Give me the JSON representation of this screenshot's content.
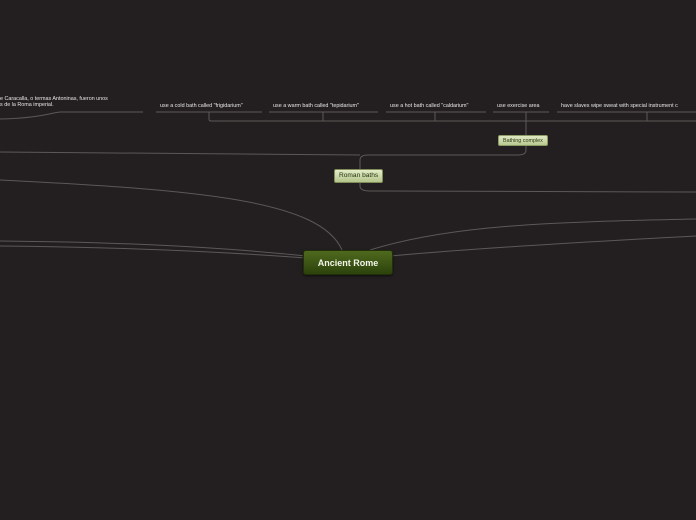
{
  "root": {
    "label": "Ancient Rome"
  },
  "branch": {
    "label": "Roman baths"
  },
  "sub_branch": {
    "label": "Bathing complex"
  },
  "leaves": [
    {
      "label": "use a cold bath called \"frigidarium\""
    },
    {
      "label": "use a warm bath called \"tepidarium\""
    },
    {
      "label": "use a hot bath called \"caldarium\""
    },
    {
      "label": "use exercise area"
    },
    {
      "label": "have slaves wipe sweat with special instrument c"
    }
  ],
  "note": {
    "line1": "e Caracalla, o termas Antoninas, fueron unos",
    "line2": "s de la Roma imperial."
  }
}
